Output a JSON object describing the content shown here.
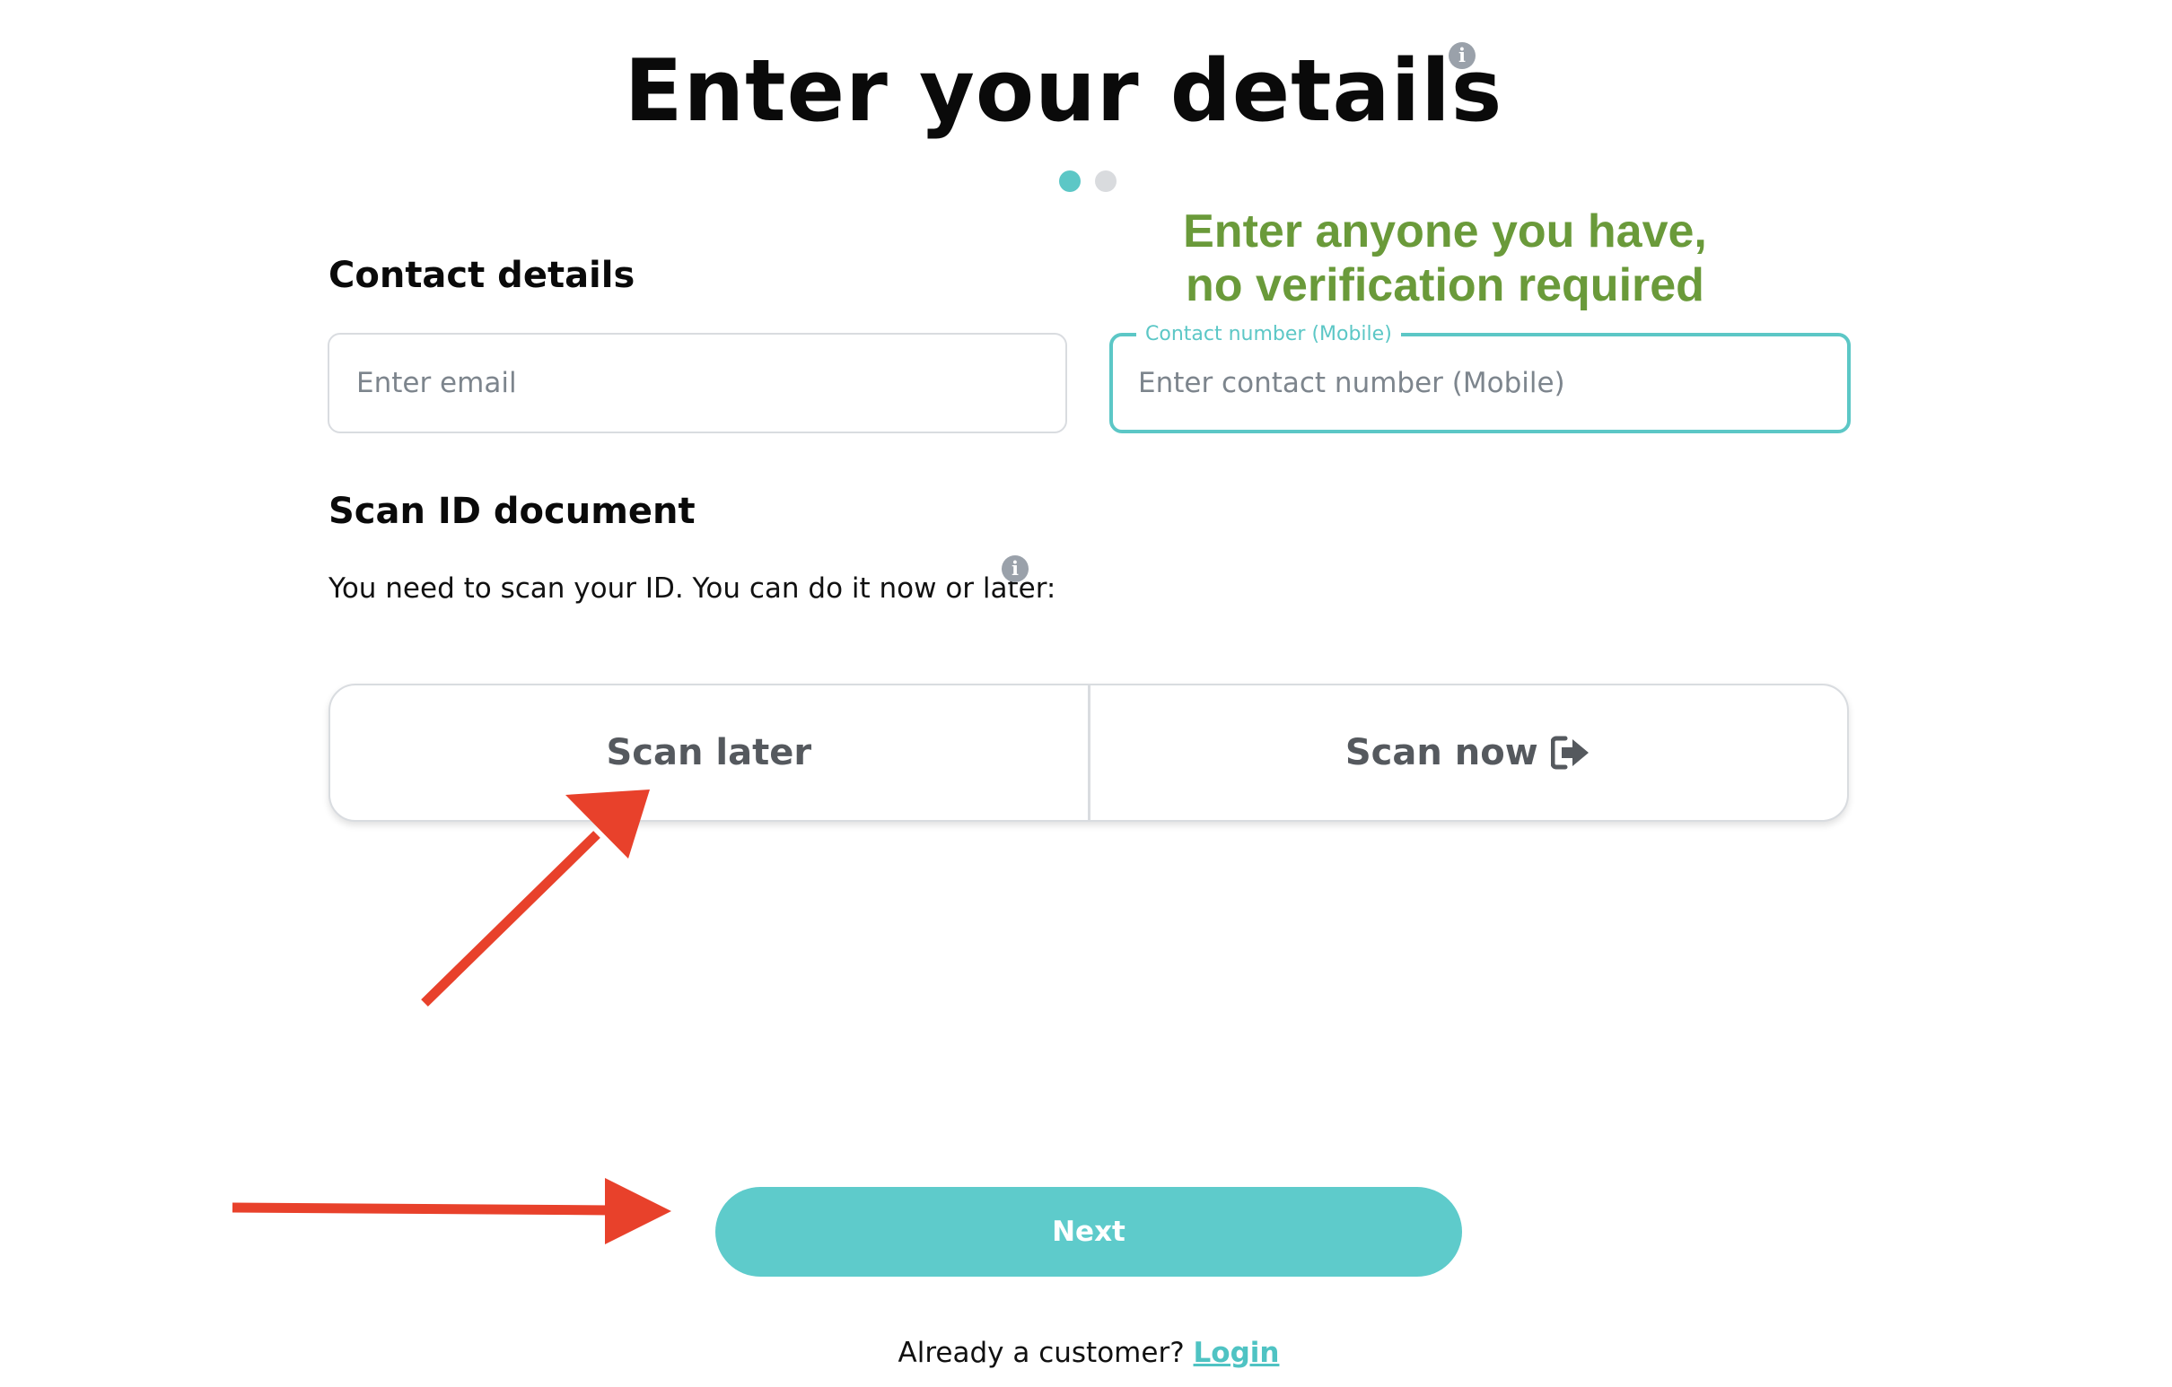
{
  "header": {
    "title": "Enter your details",
    "step_indicator": {
      "current": 1,
      "total": 2,
      "active_color": "#5cc7c6",
      "inactive_color": "#d9dbde"
    }
  },
  "annotation": {
    "line1": "Enter anyone you have,",
    "line2": "no verification required",
    "color": "#6a9a3a"
  },
  "contact": {
    "heading": "Contact details",
    "email": {
      "placeholder": "Enter email",
      "value": ""
    },
    "phone": {
      "label": "Contact number (Mobile)",
      "placeholder": "Enter contact number (Mobile)",
      "value": ""
    }
  },
  "scan": {
    "heading": "Scan ID document",
    "description": "You need to scan your ID. You can do it now or later:",
    "later_label": "Scan later",
    "now_label": "Scan now"
  },
  "actions": {
    "next_label": "Next"
  },
  "footer": {
    "prompt": "Already a customer?",
    "login_label": "Login"
  },
  "icons": {
    "title_info": "info-icon",
    "scan_info": "info-icon",
    "scan_now": "sign-in-icon",
    "arrow_color": "#e8412b"
  },
  "colors": {
    "accent": "#5ecbcb",
    "heading_text": "#0a0a0a"
  }
}
